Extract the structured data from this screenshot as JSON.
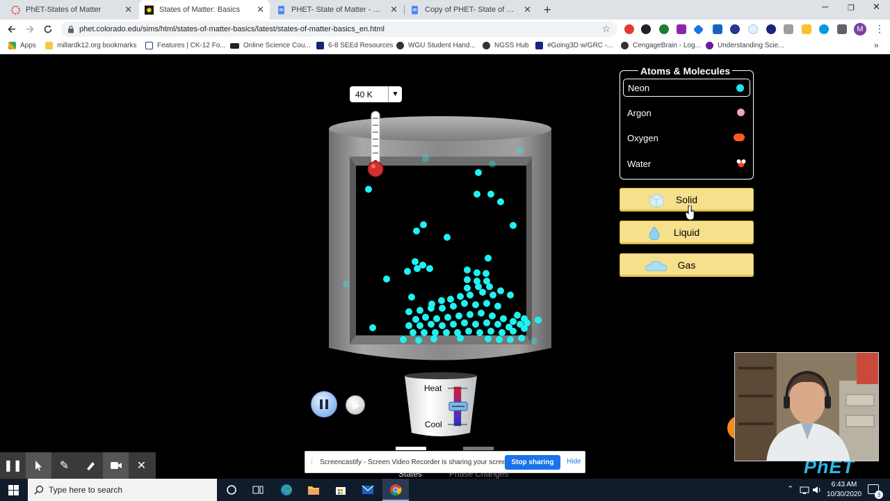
{
  "browser": {
    "tabs": [
      {
        "title": "PhET-States of Matter",
        "active": false
      },
      {
        "title": "States of Matter: Basics",
        "active": true
      },
      {
        "title": "PHET- State of Matter - Google D",
        "active": false
      },
      {
        "title": "Copy of PHET- State of Matter-b",
        "active": false
      }
    ],
    "new_tab": "+",
    "url": "phet.colorado.edu/sims/html/states-of-matter-basics/latest/states-of-matter-basics_en.html",
    "profile_initial": "M",
    "bookmarks": [
      "Apps",
      "millardk12.org bookmarks",
      "Features | CK-12 Fo...",
      "Online Science Cou...",
      "6-8 SEEd Resources",
      "WGU Student Hand...",
      "NGSS Hub",
      "#Going3D w/GRC -...",
      "CengageBrain - Log...",
      "Understanding Scie..."
    ]
  },
  "sim": {
    "temperature": "40 K",
    "atoms_title": "Atoms & Molecules",
    "atoms": [
      {
        "label": "Neon",
        "color": "#22e5f0",
        "selected": true
      },
      {
        "label": "Argon",
        "color": "#f5a3b0",
        "selected": false
      },
      {
        "label": "Oxygen",
        "color": "#ff5a1f",
        "selected": false
      },
      {
        "label": "Water",
        "color": "#ffffff",
        "selected": false
      }
    ],
    "phases": {
      "solid": "Solid",
      "liquid": "Liquid",
      "gas": "Gas"
    },
    "heater": {
      "heat": "Heat",
      "cool": "Cool"
    },
    "particle_color": "#1ff2f2",
    "bottom_tabs": {
      "states": "States",
      "phase_changes": "Phase Changes"
    },
    "logo": "PhET"
  },
  "screencastify": {
    "message": "Screencastify - Screen Video Recorder is sharing your screen.",
    "stop": "Stop sharing",
    "hide": "Hide"
  },
  "taskbar": {
    "search_placeholder": "Type here to search",
    "time": "6:43 AM",
    "date": "10/30/2020",
    "notification_count": "3"
  }
}
